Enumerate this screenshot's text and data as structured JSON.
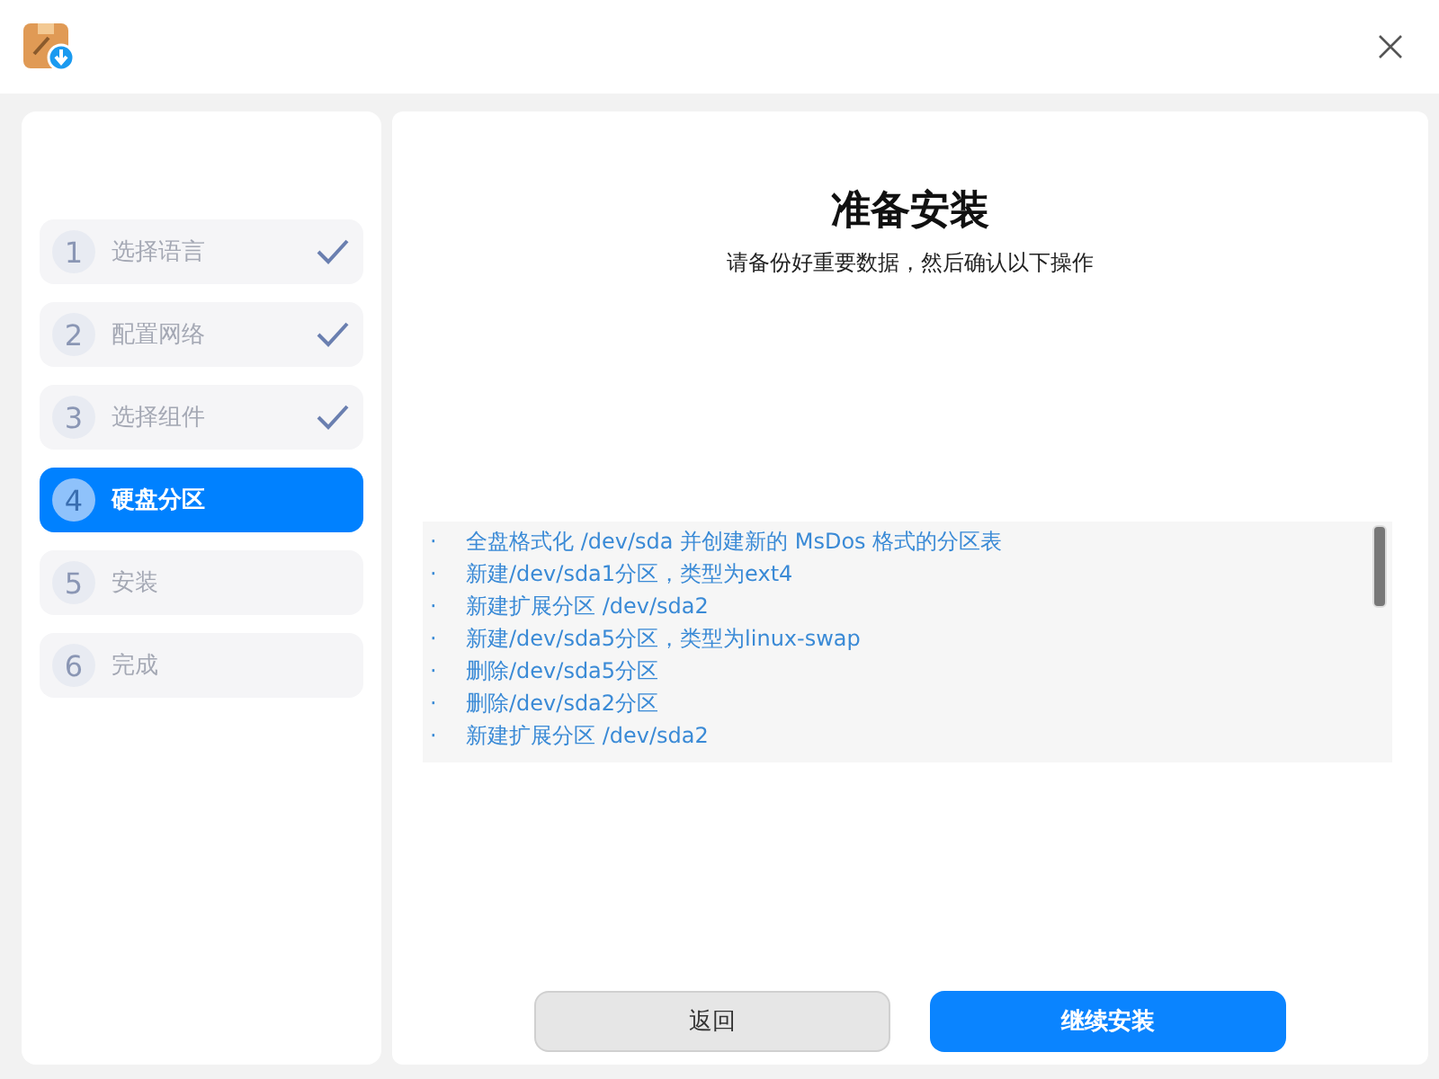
{
  "steps": [
    {
      "number": "1",
      "label": "选择语言",
      "done": true,
      "selected": false
    },
    {
      "number": "2",
      "label": "配置网络",
      "done": true,
      "selected": false
    },
    {
      "number": "3",
      "label": "选择组件",
      "done": true,
      "selected": false
    },
    {
      "number": "4",
      "label": "硬盘分区",
      "done": false,
      "selected": true
    },
    {
      "number": "5",
      "label": "安装",
      "done": false,
      "selected": false
    },
    {
      "number": "6",
      "label": "完成",
      "done": false,
      "selected": false
    }
  ],
  "title": "准备安装",
  "subtitle": "请备份好重要数据，然后确认以下操作",
  "operations": [
    {
      "bullet": "·",
      "text": "全盘格式化 /dev/sda 并创建新的 MsDos 格式的分区表"
    },
    {
      "bullet": "·",
      "text": "新建/dev/sda1分区，类型为ext4"
    },
    {
      "bullet": "·",
      "text": "新建扩展分区 /dev/sda2"
    },
    {
      "bullet": "·",
      "text": "新建/dev/sda5分区，类型为linux-swap"
    },
    {
      "bullet": "·",
      "text": "删除/dev/sda5分区"
    },
    {
      "bullet": "·",
      "text": "删除/dev/sda2分区"
    },
    {
      "bullet": "·",
      "text": "新建扩展分区 /dev/sda2"
    }
  ],
  "buttons": [
    {
      "label": "返回",
      "kind": "secondary"
    },
    {
      "label": "继续安装",
      "kind": "primary"
    }
  ]
}
